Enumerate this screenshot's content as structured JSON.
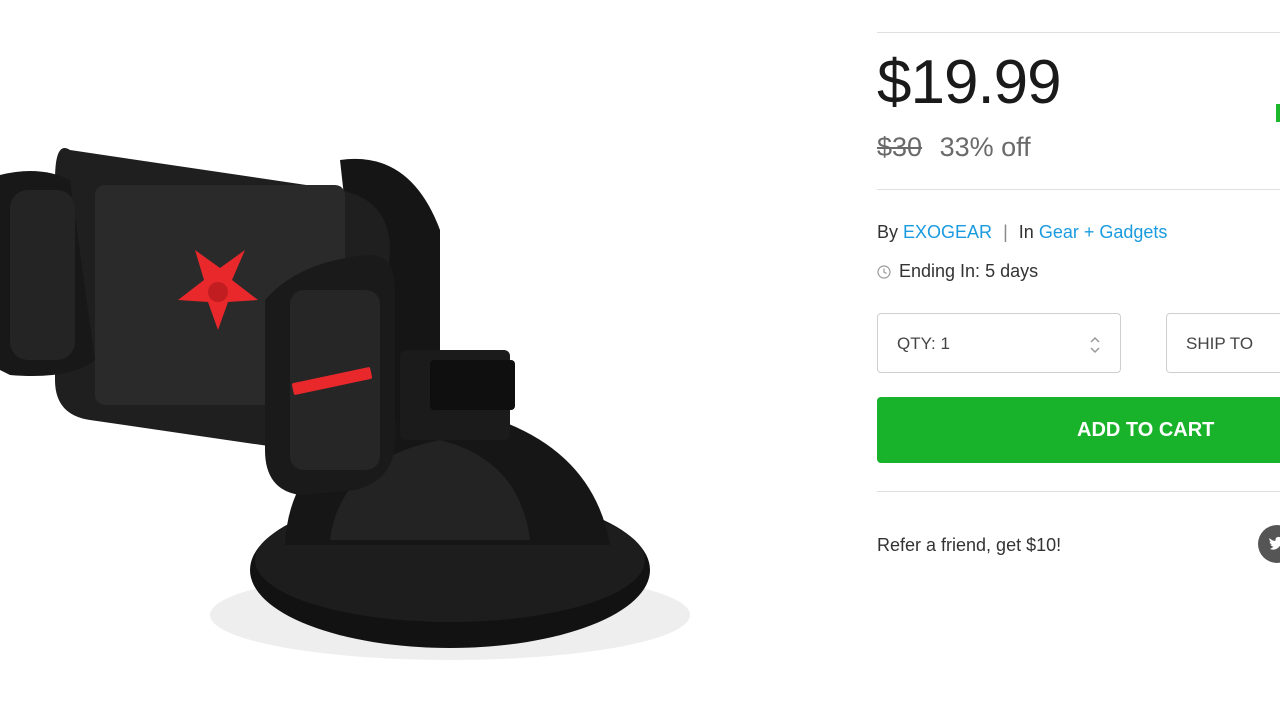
{
  "product": {
    "image_alt": "car phone mount",
    "price": "$19.99",
    "original_price": "$30",
    "discount": "33% off",
    "by_label": "By",
    "brand": "EXOGEAR",
    "separator": "|",
    "in_label": "In",
    "category": "Gear + Gadgets",
    "ending_text": "Ending In: 5 days"
  },
  "purchase": {
    "qty_label": "QTY: 1",
    "ship_label": "SHIP TO",
    "add_to_cart_label": "ADD TO CART"
  },
  "referral": {
    "text": "Refer a friend, get $10!"
  },
  "colors": {
    "cart_button": "#19b32b",
    "link": "#1a9be0",
    "accent_red": "#e8282b"
  },
  "icons": [
    "clock-icon",
    "stepper-icon",
    "twitter-icon"
  ]
}
